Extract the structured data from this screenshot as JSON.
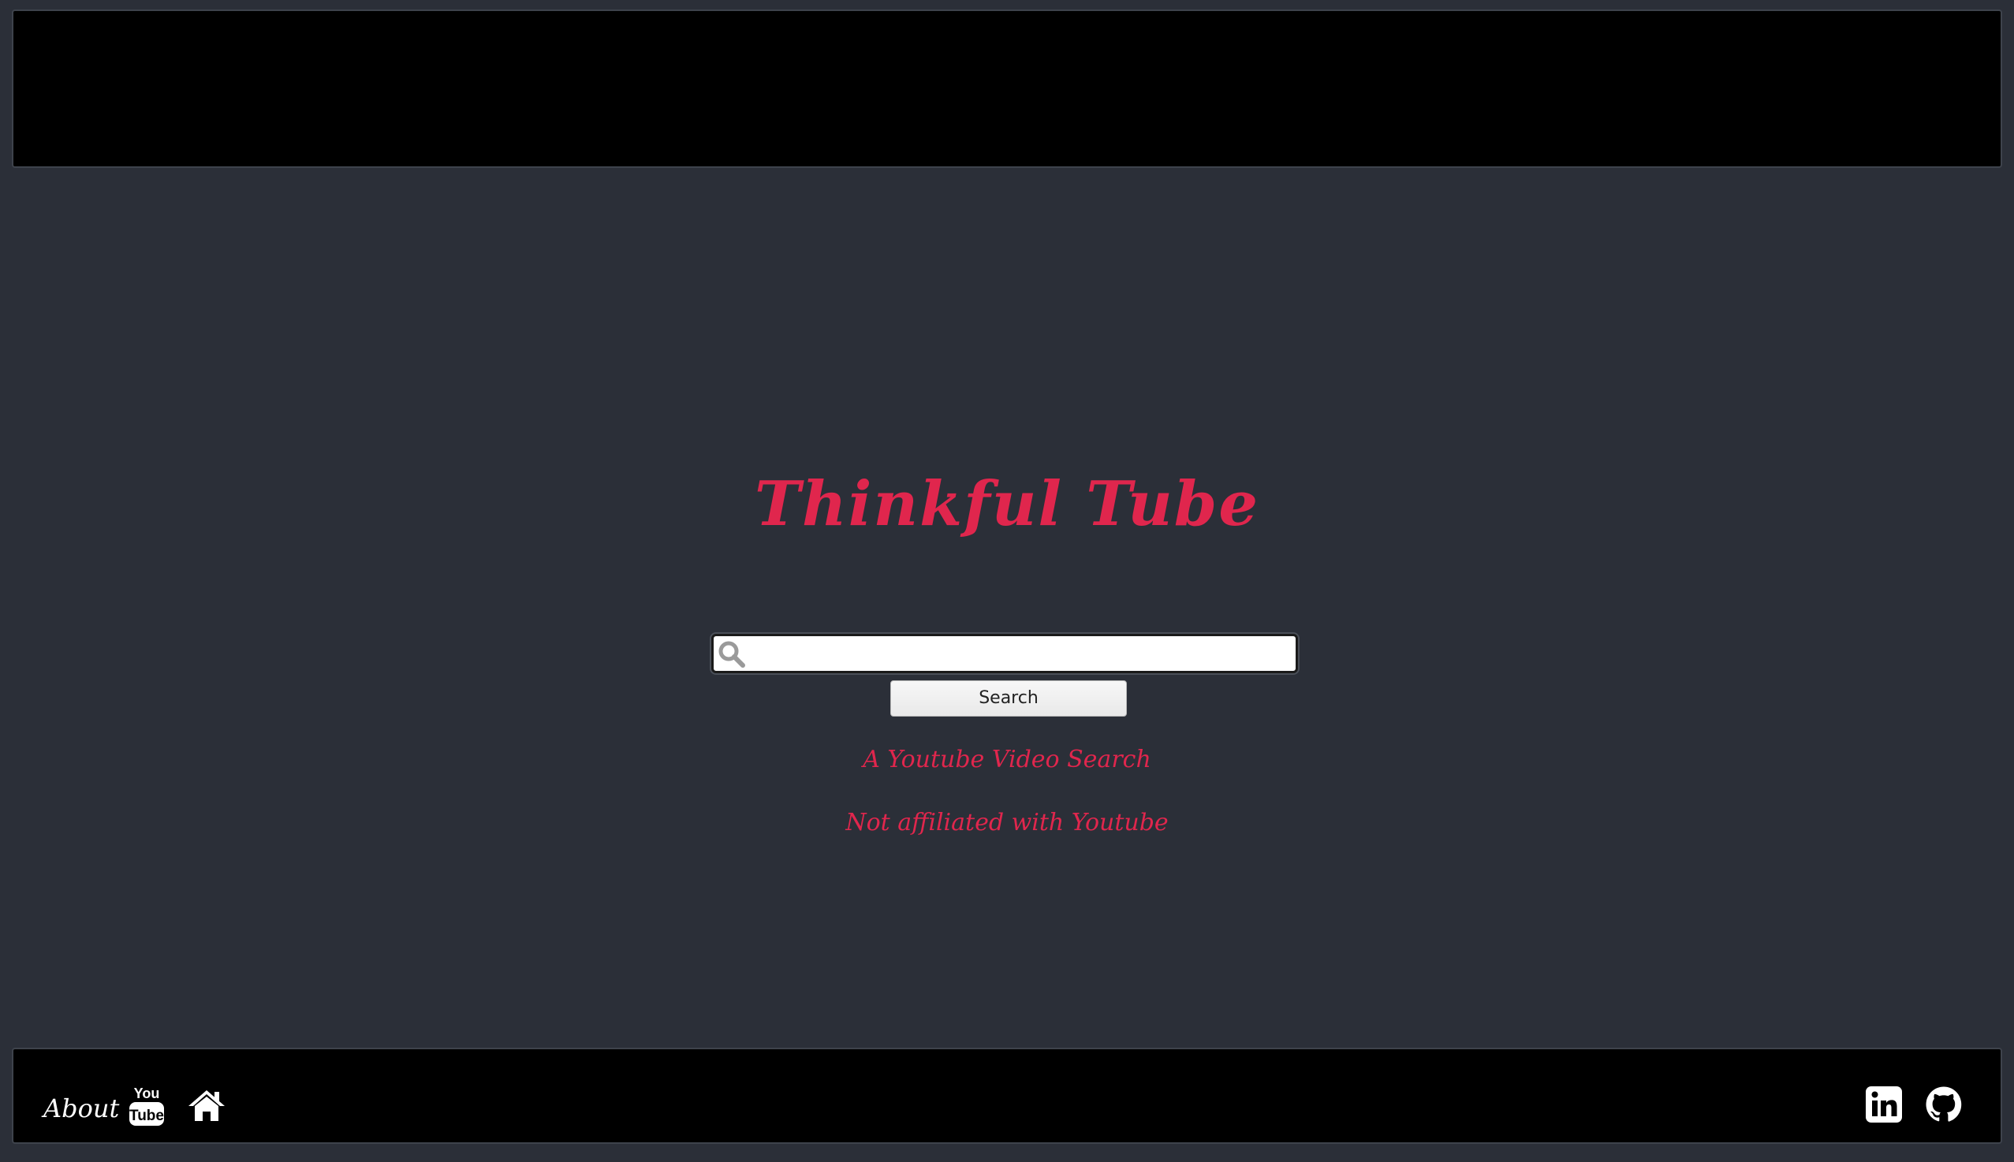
{
  "header": {},
  "main": {
    "title": "Thinkful Tube",
    "search": {
      "value": "",
      "placeholder": "",
      "icon": "search-icon",
      "button_label": "Search"
    },
    "tagline": "A Youtube Video Search",
    "disclaimer": "Not affiliated with Youtube"
  },
  "footer": {
    "about_label": "About",
    "left_icons": [
      "youtube-icon",
      "home-icon"
    ],
    "right_icons": [
      "linkedin-icon",
      "github-icon"
    ],
    "youtube_icon_text": [
      "You",
      "Tube"
    ]
  },
  "colors": {
    "background": "#2b2f38",
    "bar": "#000000",
    "accent": "#e0264d",
    "text_light": "#ffffff"
  }
}
